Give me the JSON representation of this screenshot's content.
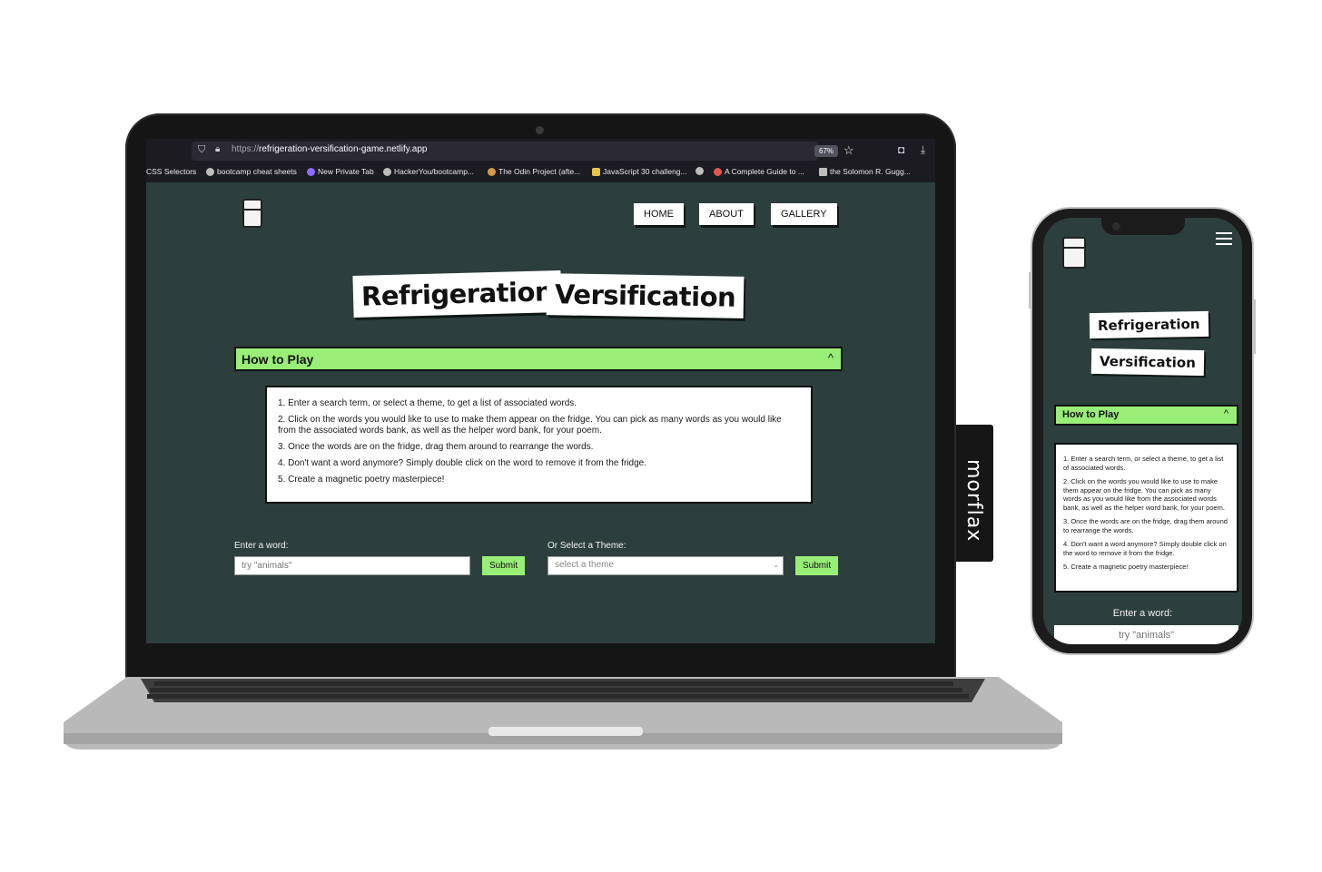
{
  "browser": {
    "url_protocol": "https://",
    "url_host": "refrigeration-versification-game.netlify.app",
    "zoom": "67%",
    "bookmarks": [
      "CSS Selectors",
      "bootcamp cheat sheets",
      "New Private Tab",
      "HackerYou/bootcamp...",
      "The Odin Project (afte...",
      "JavaScript 30 challeng...",
      "A Complete Guide to ...",
      "the Solomon R. Gugg..."
    ]
  },
  "nav": {
    "home": "HOME",
    "about": "ABOUT",
    "gallery": "GALLERY"
  },
  "title": {
    "word1": "Refrigeration",
    "word2": "Versification"
  },
  "how_to_play": {
    "label": "How to Play",
    "chevron": "^",
    "steps": [
      "1. Enter a search term, or select a theme, to get a list of associated words.",
      "2. Click on the words you would like to use to make them appear on the fridge. You can pick as many words as you would like from the associated words bank, as well as the helper word bank, for your poem.",
      "3. Once the words are on the fridge, drag them around to rearrange the words.",
      "4. Don't want a word anymore? Simply double click on the word to remove it from the fridge.",
      "5. Create a magnetic poetry masterpiece!"
    ]
  },
  "form": {
    "word_label": "Enter a word:",
    "word_placeholder": "try \"animals\"",
    "submit": "Submit",
    "theme_label": "Or Select a Theme:",
    "theme_placeholder": "select a theme"
  },
  "brand": {
    "watermark": "morflax"
  },
  "colors": {
    "page_bg": "#2c3f3c",
    "accent_green": "#98ee76"
  }
}
